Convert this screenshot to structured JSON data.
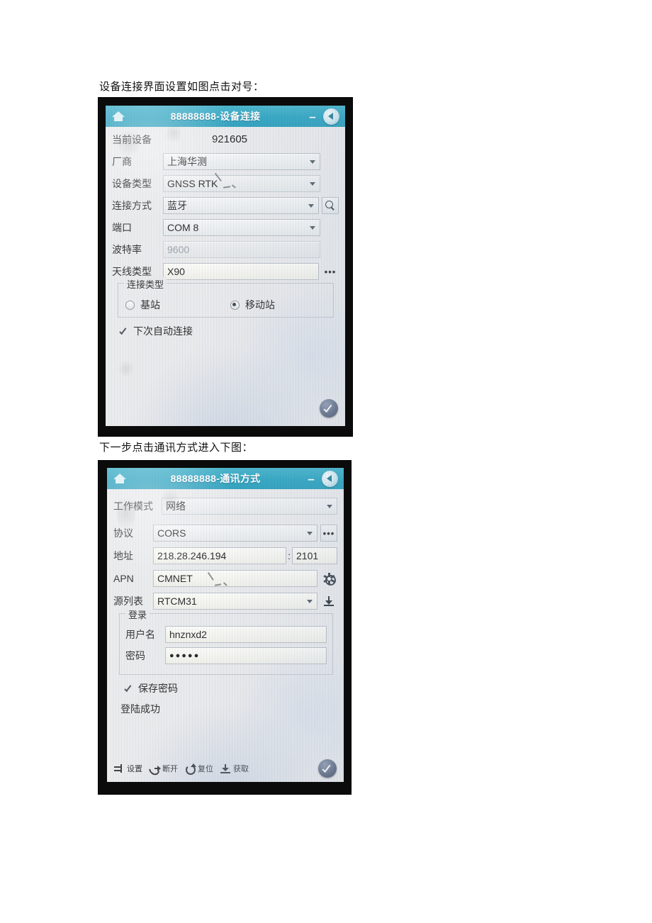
{
  "document": {
    "paragraph_1": "设备连接界面设置如图点击对号：",
    "paragraph_2": "下一步点击通讯方式进入下图："
  },
  "colors": {
    "titlebar": "#2ea5c2",
    "screen_bg": "#e9eaec",
    "bezel": "#0b0b0b",
    "ok_button": "#5f6b82",
    "field_bg": "#eef0f1"
  },
  "screenshot_1": {
    "titlebar": {
      "home_icon": "home-icon",
      "title": "88888888-设备连接",
      "minimize_label": "–",
      "back_icon": "back-arrow-icon"
    },
    "fields": [
      {
        "label": "当前设备",
        "value": "921605",
        "type": "static"
      },
      {
        "label": "厂商",
        "value": "上海华测",
        "type": "dropdown"
      },
      {
        "label": "设备类型",
        "value": "GNSS RTK",
        "type": "dropdown"
      },
      {
        "label": "连接方式",
        "value": "蓝牙",
        "type": "dropdown",
        "trailing_icon": "search-icon"
      },
      {
        "label": "端口",
        "value": "COM 8",
        "type": "dropdown"
      },
      {
        "label": "波特率",
        "value": "9600",
        "type": "dropdown-disabled"
      },
      {
        "label": "天线类型",
        "value": "X90",
        "type": "text",
        "trailing_icon": "ellipsis-icon"
      }
    ],
    "connection_group": {
      "legend": "连接类型",
      "options": [
        {
          "label": "基站",
          "selected": false
        },
        {
          "label": "移动站",
          "selected": true
        }
      ]
    },
    "auto_connect": {
      "label": "下次自动连接",
      "checked": true
    },
    "ok_button": {
      "icon": "check-icon"
    }
  },
  "screenshot_2": {
    "titlebar": {
      "home_icon": "home-icon",
      "title": "88888888-通讯方式",
      "minimize_label": "–",
      "back_icon": "back-arrow-icon"
    },
    "work_mode": {
      "label": "工作模式",
      "value": "网络",
      "type": "dropdown"
    },
    "fields": [
      {
        "label": "协议",
        "value": "CORS",
        "type": "dropdown",
        "trailing_icon": "ellipsis-icon"
      },
      {
        "label": "地址",
        "value": "218.28.246.194",
        "separator": ":",
        "port": "2101",
        "type": "text-port"
      },
      {
        "label": "APN",
        "value": "CMNET",
        "type": "text",
        "trailing_icon": "gear-icon"
      },
      {
        "label": "源列表",
        "value": "RTCM31",
        "type": "dropdown",
        "trailing_icon": "download-icon"
      }
    ],
    "login_group": {
      "legend": "登录",
      "username": {
        "label": "用户名",
        "value": "hnznxd2"
      },
      "password": {
        "label": "密码",
        "value": "●●●●●"
      }
    },
    "save_password": {
      "label": "保存密码",
      "checked": true
    },
    "status": "登陆成功",
    "toolbar": [
      {
        "label": "设置",
        "icon": "settings-icon"
      },
      {
        "label": "断开",
        "icon": "disconnect-icon"
      },
      {
        "label": "复位",
        "icon": "reset-icon"
      },
      {
        "label": "获取",
        "icon": "download-icon"
      }
    ],
    "ok_button": {
      "icon": "check-icon"
    }
  }
}
